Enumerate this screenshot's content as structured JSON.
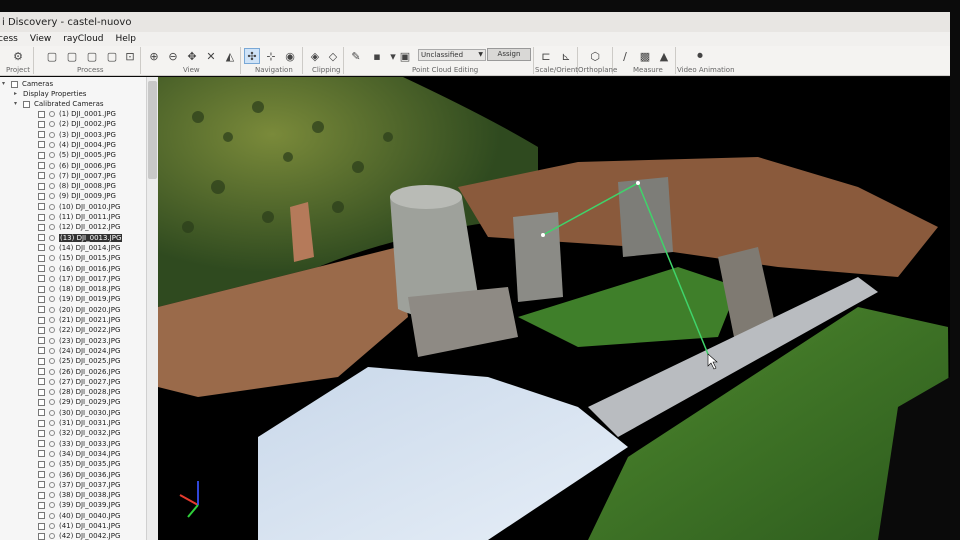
{
  "window": {
    "title": "i Discovery - castel-nuovo"
  },
  "menu": [
    "cess",
    "View",
    "rayCloud",
    "Help"
  ],
  "ribbon": {
    "groups": {
      "project": "Project",
      "process": "Process",
      "view": "View",
      "navigation": "Navigation",
      "clipping": "Clipping",
      "point_cloud_editing": "Point Cloud Editing",
      "scale_orient": "Scale/Orient",
      "orthoplane": "Orthoplane",
      "measure": "Measure",
      "video_animation": "Video Animation"
    },
    "class_combo": "Unclassified",
    "assign_button": "Assign"
  },
  "tree": {
    "cameras": "Cameras",
    "display_properties": "Display Properties",
    "calibrated_cameras": "Calibrated Cameras",
    "images": [
      "(1) DJI_0001.JPG",
      "(2) DJI_0002.JPG",
      "(3) DJI_0003.JPG",
      "(4) DJI_0004.JPG",
      "(5) DJI_0005.JPG",
      "(6) DJI_0006.JPG",
      "(7) DJI_0007.JPG",
      "(8) DJI_0008.JPG",
      "(9) DJI_0009.JPG",
      "(10) DJI_0010.JPG",
      "(11) DJI_0011.JPG",
      "(12) DJI_0012.JPG",
      "(13) DJI_0013.JPG",
      "(14) DJI_0014.JPG",
      "(15) DJI_0015.JPG",
      "(16) DJI_0016.JPG",
      "(17) DJI_0017.JPG",
      "(18) DJI_0018.JPG",
      "(19) DJI_0019.JPG",
      "(20) DJI_0020.JPG",
      "(21) DJI_0021.JPG",
      "(22) DJI_0022.JPG",
      "(23) DJI_0023.JPG",
      "(24) DJI_0024.JPG",
      "(25) DJI_0025.JPG",
      "(26) DJI_0026.JPG",
      "(27) DJI_0027.JPG",
      "(28) DJI_0028.JPG",
      "(29) DJI_0029.JPG",
      "(30) DJI_0030.JPG",
      "(31) DJI_0031.JPG",
      "(32) DJI_0032.JPG",
      "(33) DJI_0033.JPG",
      "(34) DJI_0034.JPG",
      "(35) DJI_0035.JPG",
      "(36) DJI_0036.JPG",
      "(37) DJI_0037.JPG",
      "(38) DJI_0038.JPG",
      "(39) DJI_0039.JPG",
      "(40) DJI_0040.JPG",
      "(41) DJI_0041.JPG",
      "(42) DJI_0042.JPG"
    ],
    "selected_index": 12
  },
  "colors": {
    "measure_line": "#3fd46a",
    "selected_bg": "#333333",
    "active_tool": "#cfe3f7"
  }
}
